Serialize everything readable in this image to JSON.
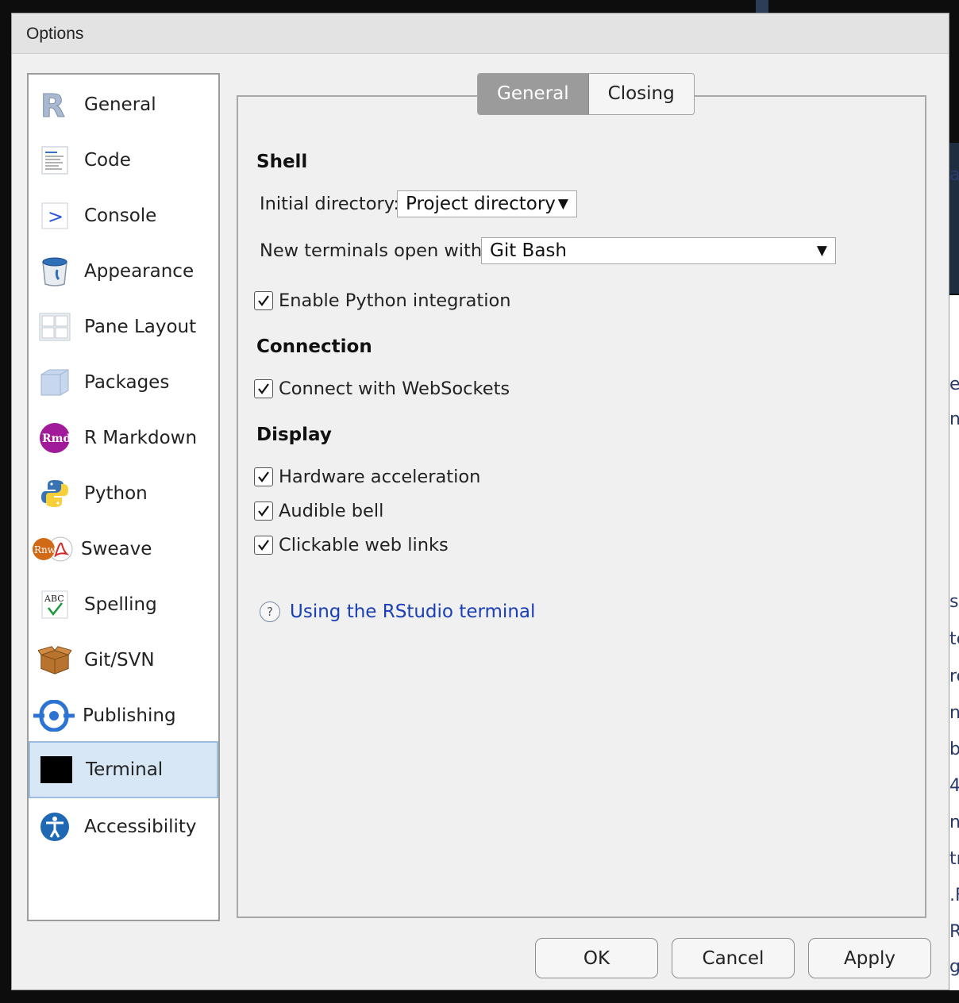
{
  "dialog": {
    "title": "Options"
  },
  "background": {
    "letters": [
      "a",
      "e",
      "n.",
      "s",
      "te",
      "re",
      "n",
      "b",
      "4",
      "n",
      "tr",
      ".F",
      "R",
      "g."
    ]
  },
  "sidebar": {
    "items": [
      {
        "label": "General",
        "icon": "r-logo-icon"
      },
      {
        "label": "Code",
        "icon": "code-icon"
      },
      {
        "label": "Console",
        "icon": "console-icon"
      },
      {
        "label": "Appearance",
        "icon": "paint-bucket-icon"
      },
      {
        "label": "Pane Layout",
        "icon": "pane-layout-icon"
      },
      {
        "label": "Packages",
        "icon": "package-cube-icon"
      },
      {
        "label": "R Markdown",
        "icon": "rmd-icon"
      },
      {
        "label": "Python",
        "icon": "python-icon"
      },
      {
        "label": "Sweave",
        "icon": "sweave-icon"
      },
      {
        "label": "Spelling",
        "icon": "spelling-icon"
      },
      {
        "label": "Git/SVN",
        "icon": "git-box-icon"
      },
      {
        "label": "Publishing",
        "icon": "publishing-icon"
      },
      {
        "label": "Terminal",
        "icon": "terminal-icon",
        "selected": true
      },
      {
        "label": "Accessibility",
        "icon": "accessibility-icon"
      }
    ]
  },
  "tabs": [
    {
      "label": "General",
      "active": true
    },
    {
      "label": "Closing",
      "active": false
    }
  ],
  "shell": {
    "heading": "Shell",
    "initial_directory_label": "Initial directory:",
    "initial_directory_value": "Project directory",
    "new_terminals_label": "New terminals open with:",
    "new_terminals_value": "Git Bash",
    "python_integration_label": "Enable Python integration",
    "python_integration_checked": true
  },
  "connection": {
    "heading": "Connection",
    "websockets_label": "Connect with WebSockets",
    "websockets_checked": true
  },
  "display": {
    "heading": "Display",
    "hardware_label": "Hardware acceleration",
    "hardware_checked": true,
    "bell_label": "Audible bell",
    "bell_checked": true,
    "links_label": "Clickable web links",
    "links_checked": true
  },
  "help_link": "Using the RStudio terminal",
  "buttons": {
    "ok": "OK",
    "cancel": "Cancel",
    "apply": "Apply"
  },
  "colors": {
    "link": "#1a3fb5",
    "selected_bg": "#d7e7f6",
    "tab_active": "#9b9b9b"
  }
}
